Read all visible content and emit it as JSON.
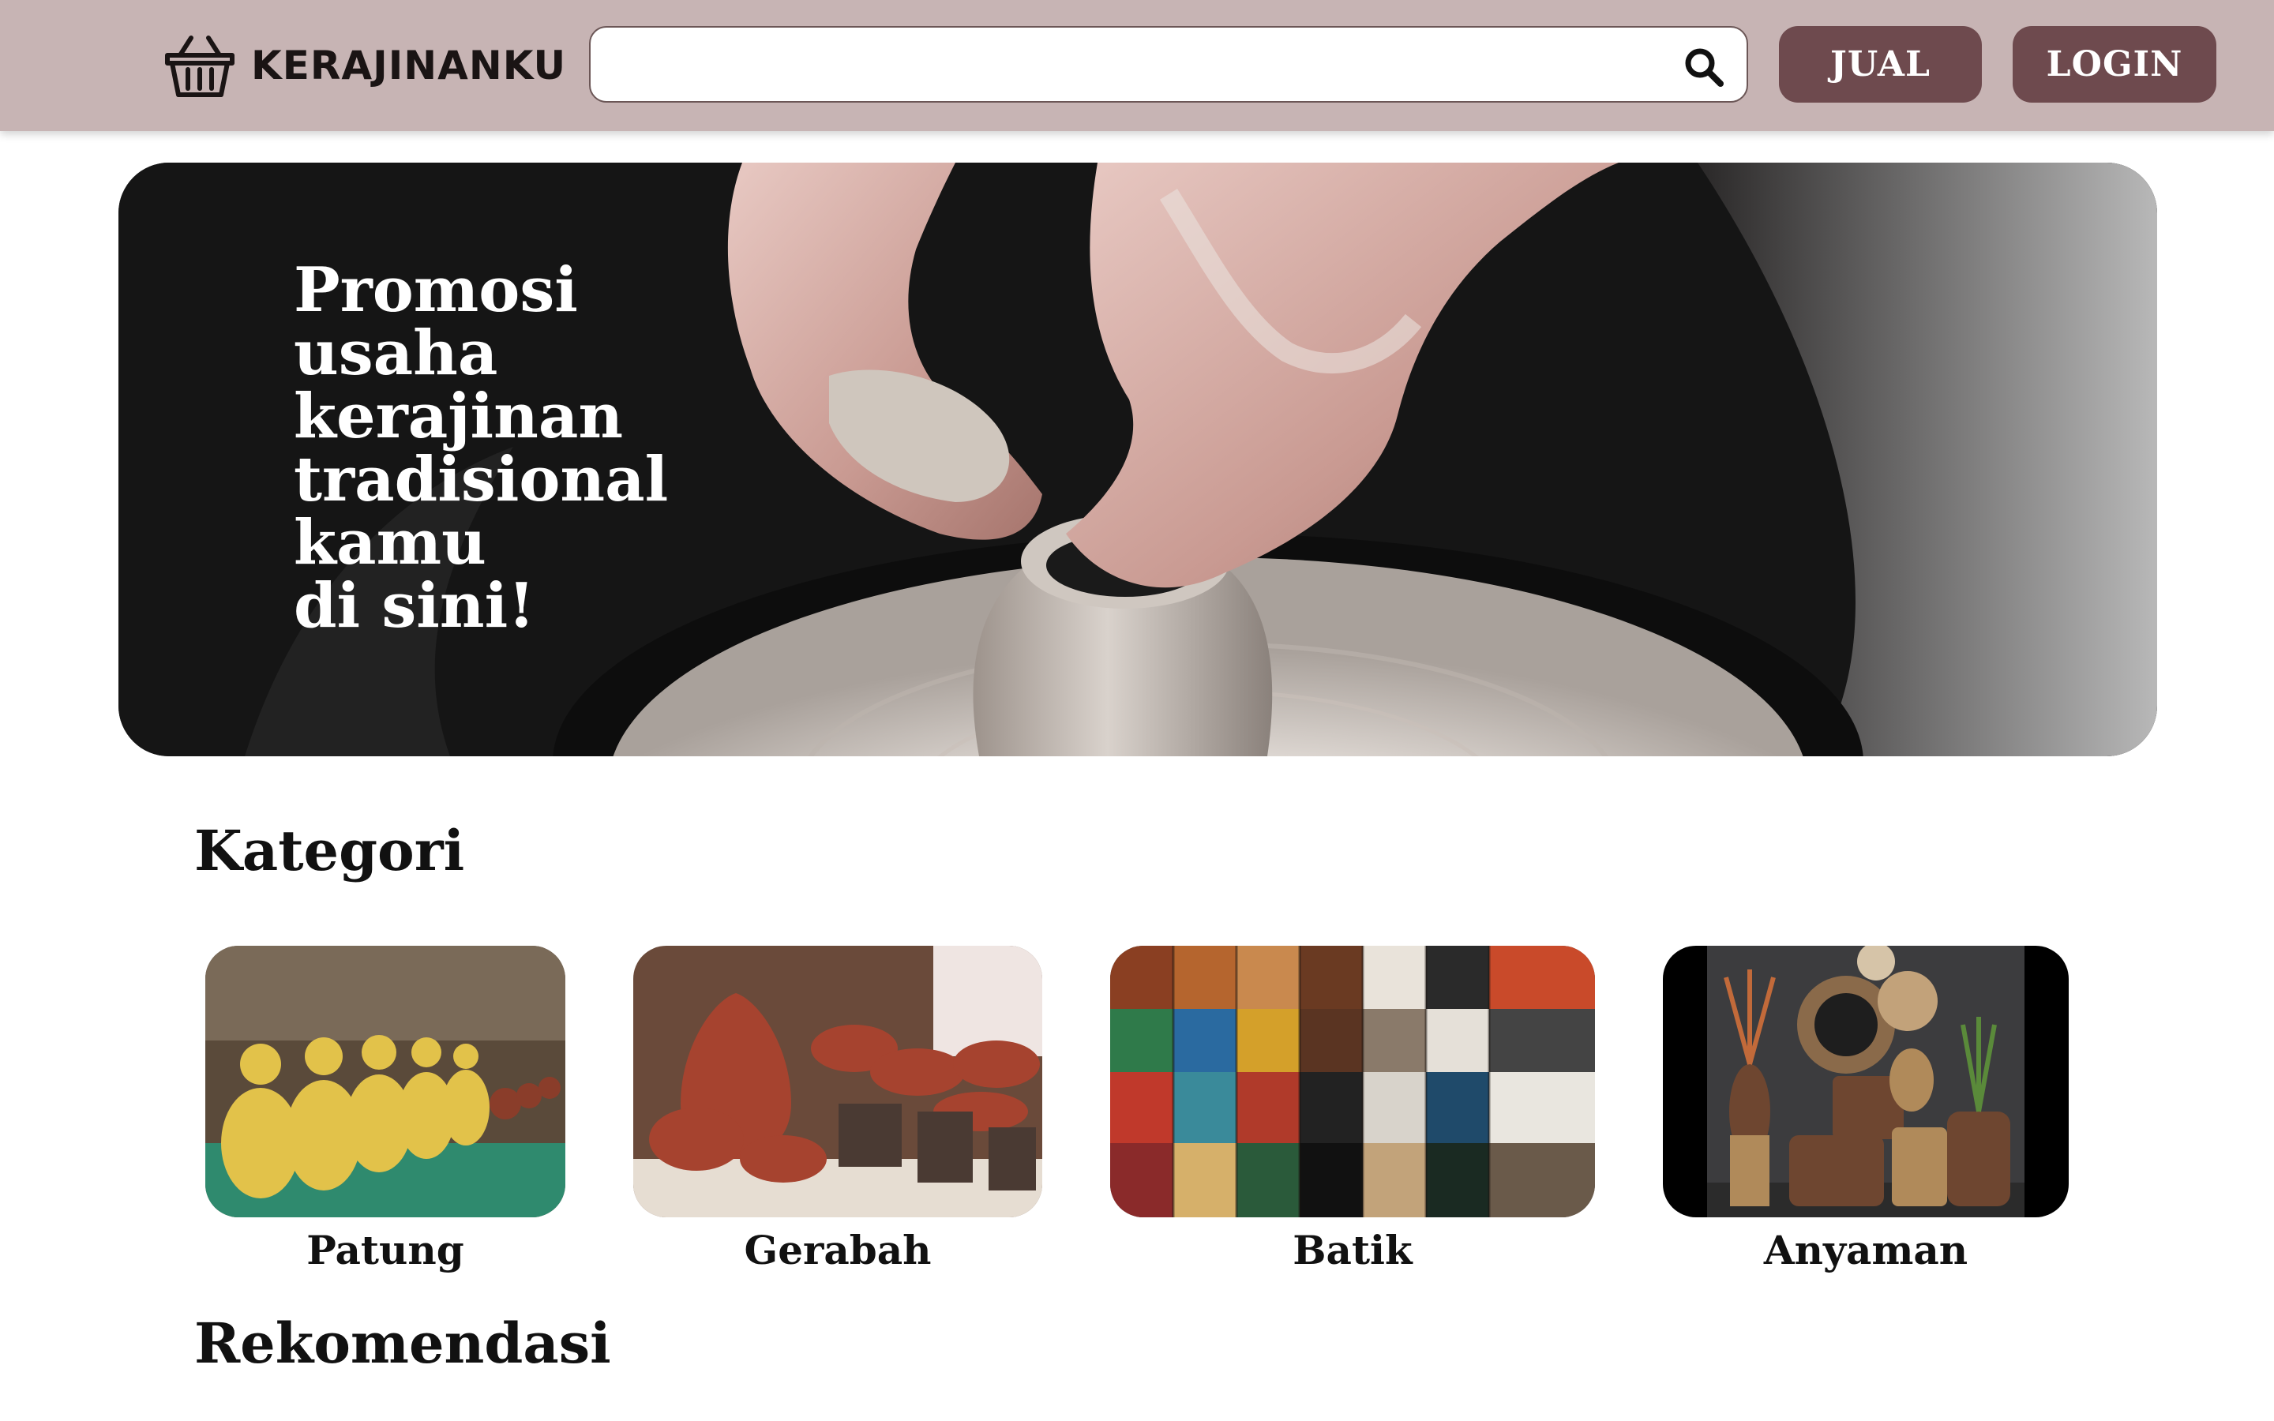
{
  "header": {
    "brand": "KERAJINANKU",
    "brand_icon": "basket-icon",
    "search": {
      "placeholder": "",
      "value": "",
      "icon": "search-icon"
    },
    "buttons": {
      "sell_label": "JUAL",
      "login_label": "LOGIN"
    },
    "colors": {
      "bar": "#c7b4b4",
      "button": "#6e4a4e"
    }
  },
  "hero": {
    "lines": [
      "Promosi",
      "usaha",
      "kerajinan",
      "tradisional",
      "kamu",
      "di sini!"
    ]
  },
  "categories": {
    "title": "Kategori",
    "items": [
      {
        "label": "Patung"
      },
      {
        "label": "Gerabah"
      },
      {
        "label": "Batik"
      },
      {
        "label": "Anyaman"
      }
    ]
  },
  "recommendations": {
    "title": "Rekomendasi"
  }
}
